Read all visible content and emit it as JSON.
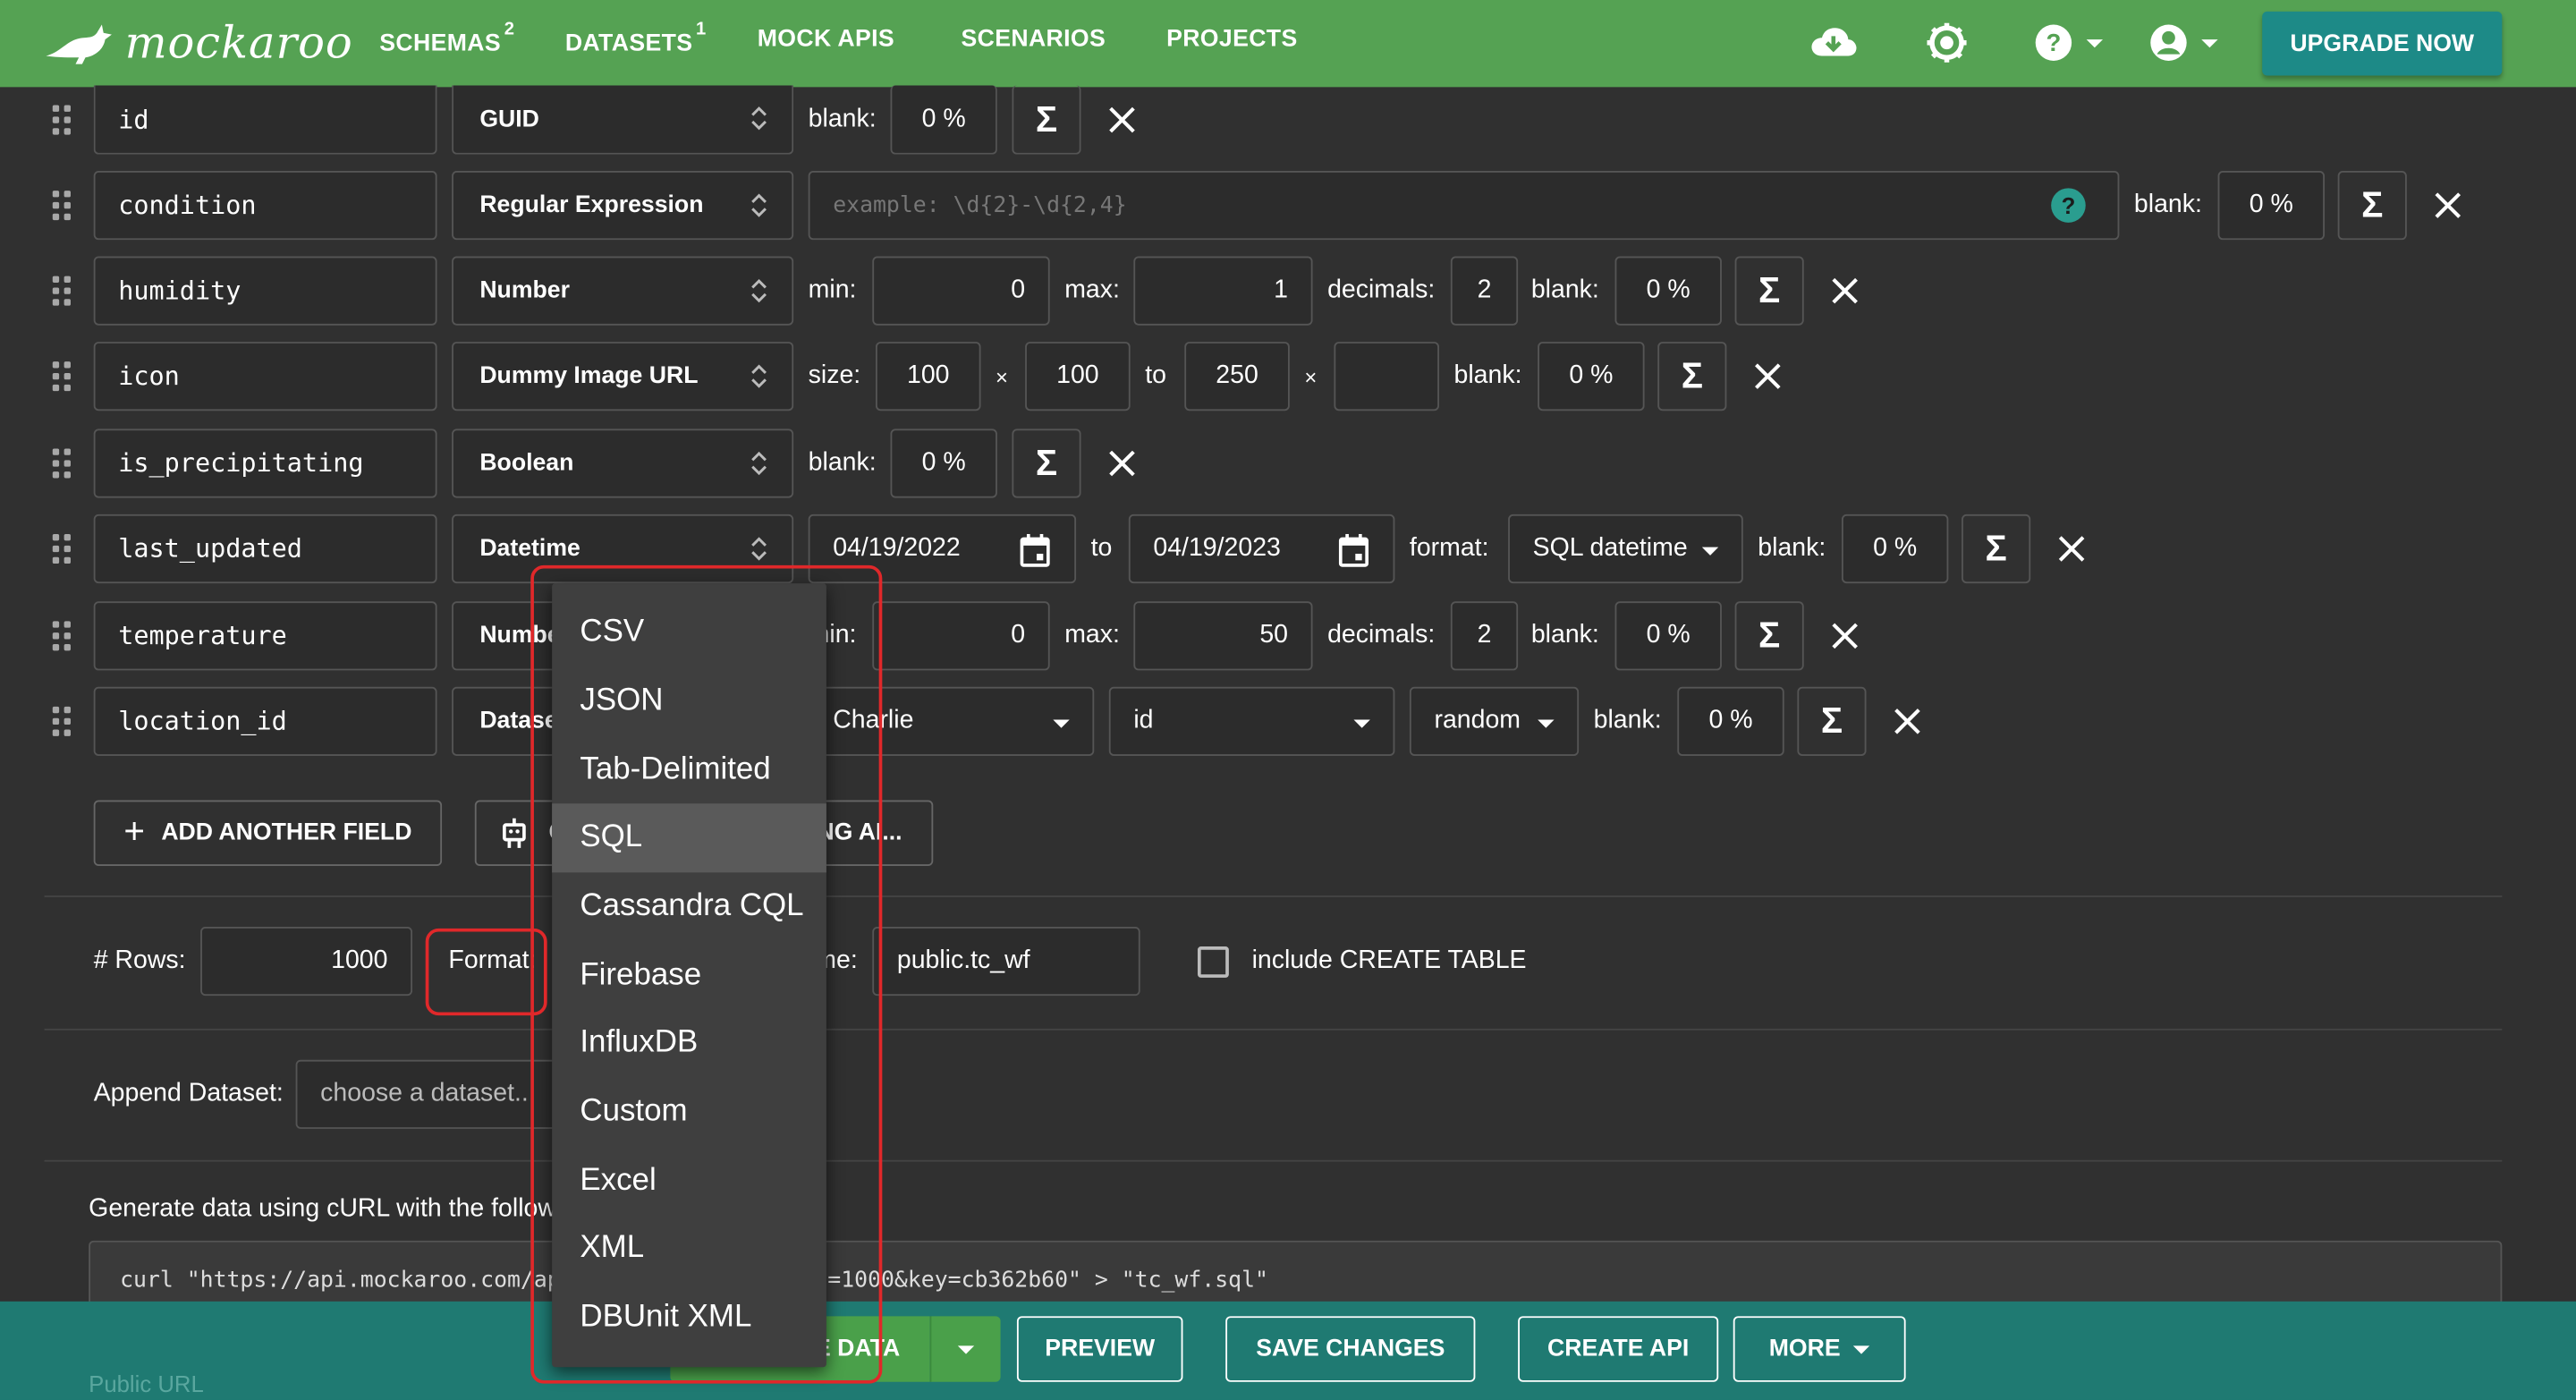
{
  "topbar": {
    "logo": "mockaroo",
    "nav": [
      {
        "label": "SCHEMAS",
        "badge": "2"
      },
      {
        "label": "DATASETS",
        "badge": "1"
      },
      {
        "label": "MOCK APIS",
        "badge": ""
      },
      {
        "label": "SCENARIOS",
        "badge": ""
      },
      {
        "label": "PROJECTS",
        "badge": ""
      }
    ],
    "icons": [
      "cloud-download-icon",
      "settings-icon",
      "help-icon",
      "account-icon"
    ],
    "upgrade_label": "UPGRADE NOW"
  },
  "fields": [
    {
      "name": "id",
      "type": "GUID",
      "blank_label": "blank:",
      "blank": "0 %"
    },
    {
      "name": "condition",
      "type": "Regular Expression",
      "placeholder": "example: \\d{2}-\\d{2,4}",
      "blank_label": "blank:",
      "blank": "0 %"
    },
    {
      "name": "humidity",
      "type": "Number",
      "min_label": "min:",
      "min": "0",
      "max_label": "max:",
      "max": "1",
      "decimals_label": "decimals:",
      "decimals": "2",
      "blank_label": "blank:",
      "blank": "0 %"
    },
    {
      "name": "icon",
      "type": "Dummy Image URL",
      "size_label": "size:",
      "w": "100",
      "x1": "×",
      "h": "100",
      "to": "to",
      "w2": "250",
      "x2": "×",
      "h2": "",
      "blank_label": "blank:",
      "blank": "0 %"
    },
    {
      "name": "is_precipitating",
      "type": "Boolean",
      "blank_label": "blank:",
      "blank": "0 %"
    },
    {
      "name": "last_updated",
      "type": "Datetime",
      "from": "04/19/2022",
      "to_label": "to",
      "to": "04/19/2023",
      "format_label": "format:",
      "format": "SQL datetime",
      "blank_label": "blank:",
      "blank": "0 %"
    },
    {
      "name": "temperature",
      "type": "Number",
      "min_label": "min:",
      "min": "0",
      "max_label": "max:",
      "max": "50",
      "decimals_label": "decimals:",
      "decimals": "2",
      "blank_label": "blank:",
      "blank": "0 %"
    },
    {
      "name": "location_id",
      "type": "Dataset Column",
      "dataset": "Charlie",
      "column": "id",
      "mode": "random",
      "blank_label": "blank:",
      "blank": "0 %"
    }
  ],
  "actions": {
    "add_field": "ADD ANOTHER FIELD",
    "generate_ai": "GENERATE FIELDS USING AI..."
  },
  "options": {
    "rows_label": "# Rows:",
    "rows": "1000",
    "format_label": "Format:",
    "table_label": "Table Name:",
    "table": "public.tc_wf",
    "create_table_label": "include CREATE TABLE"
  },
  "append": {
    "label": "Append Dataset:",
    "placeholder": "choose a dataset..."
  },
  "curl": {
    "label": "Generate data using cURL with the following command:",
    "command": "curl \"https://api.mockaroo.com/api/generate.sql?count=1000&key=cb362b60\" > \"tc_wf.sql\""
  },
  "public_url_label": "Public URL",
  "bottom": {
    "generate": "GENERATE DATA",
    "preview": "PREVIEW",
    "save": "SAVE CHANGES",
    "create_api": "CREATE API",
    "more": "MORE"
  },
  "format_menu": {
    "items": [
      "CSV",
      "JSON",
      "Tab-Delimited",
      "SQL",
      "Cassandra CQL",
      "Firebase",
      "InfluxDB",
      "Custom",
      "Excel",
      "XML",
      "DBUnit XML"
    ],
    "selected": "SQL"
  },
  "colors": {
    "topbar": "#55a253",
    "accent": "#1d8a87",
    "bottom": "#1f7a72",
    "highlight": "#e0282a"
  }
}
